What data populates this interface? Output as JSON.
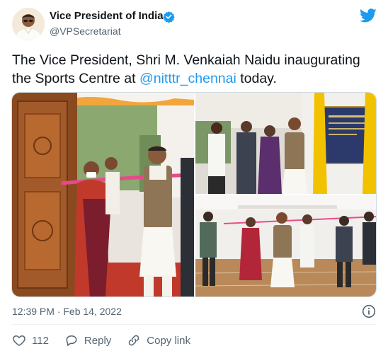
{
  "user": {
    "display_name": "Vice President of India",
    "handle": "@VPSecretariat",
    "verified": true,
    "avatar_icon": "portrait-avatar"
  },
  "tweet": {
    "text_before": "The Vice President, Shri M. Venkaiah Naidu inaugurating the Sports Centre at ",
    "mention": "@nitttr_chennai",
    "text_after": " today.",
    "timestamp": "12:39 PM · Feb 14, 2022"
  },
  "media": {
    "photos": [
      "photo-ribbon-cutting",
      "photo-plaque-unveiling",
      "photo-hall-walkthrough"
    ]
  },
  "actions": {
    "like_count": "112",
    "reply_label": "Reply",
    "copy_link_label": "Copy link"
  },
  "colors": {
    "accent": "#1d9bf0",
    "text_primary": "#0f1419",
    "text_secondary": "#536471",
    "like": "#536471"
  }
}
